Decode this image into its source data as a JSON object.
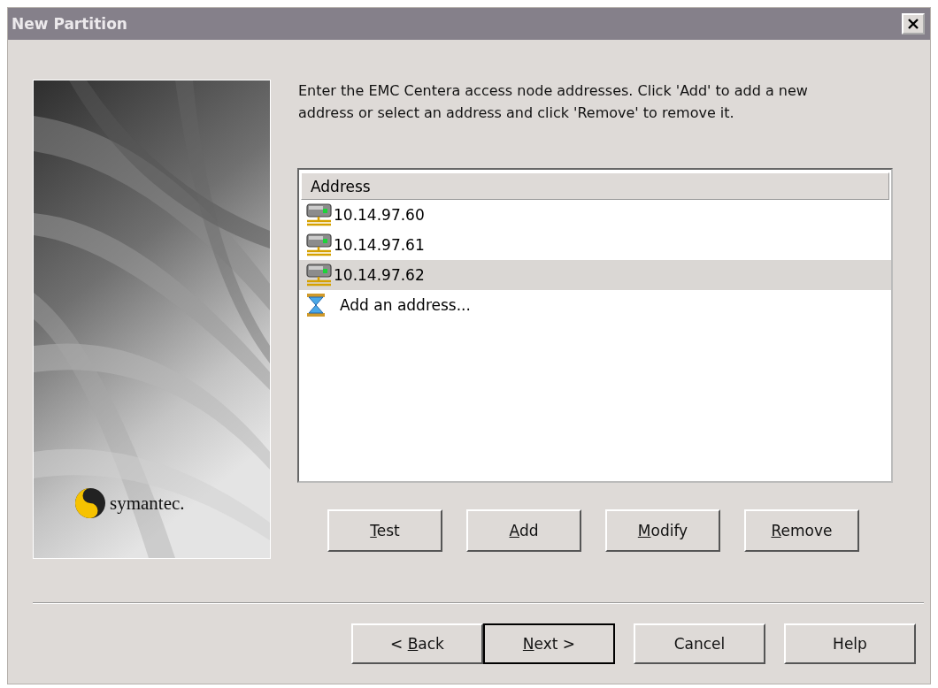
{
  "window": {
    "title": "New Partition"
  },
  "logo": {
    "text": "symantec."
  },
  "instructions": "Enter the EMC Centera access node addresses. Click 'Add' to add a new address or select an address and click 'Remove' to remove it.",
  "address_list": {
    "header": "Address",
    "rows": [
      {
        "kind": "server",
        "text": "10.14.97.60",
        "selected": false
      },
      {
        "kind": "server",
        "text": "10.14.97.61",
        "selected": false
      },
      {
        "kind": "server",
        "text": "10.14.97.62",
        "selected": true
      },
      {
        "kind": "add",
        "text": "Add an address...",
        "selected": false
      }
    ]
  },
  "list_buttons": [
    {
      "key": "T",
      "after": "est",
      "default": false
    },
    {
      "key": "A",
      "after": "dd",
      "default": false
    },
    {
      "key": "M",
      "after": "odify",
      "default": false
    },
    {
      "key": "R",
      "after": "emove",
      "default": false
    }
  ],
  "wizard_buttons": [
    {
      "before": "< ",
      "key": "B",
      "after": "ack",
      "default": false
    },
    {
      "key": "N",
      "after": "ext >",
      "default": true
    },
    {
      "before": "Cancel",
      "default": false
    },
    {
      "before": "Help",
      "default": false
    }
  ]
}
